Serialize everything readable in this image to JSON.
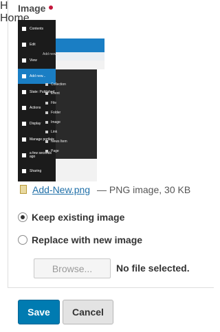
{
  "field": {
    "label": "Image"
  },
  "preview": {
    "toolbar_items": [
      "Contents",
      "Edit",
      "View",
      "Add new...",
      "State: Published",
      "Actions",
      "Display",
      "Manage portlets",
      "a few seconds ago",
      "Sharing"
    ],
    "submenu_title": "Add new...",
    "submenu_items": [
      "Collection",
      "Event",
      "File",
      "Folder",
      "Image",
      "Link",
      "News Item",
      "Page"
    ],
    "site_nav_text": "H",
    "breadcrumb_text": "Home"
  },
  "file": {
    "name": "Add-New.png",
    "meta": "— PNG image, 30 KB",
    "icon": "image-file-icon"
  },
  "options": {
    "keep_label": "Keep existing image",
    "replace_label": "Replace with new image",
    "selected": "keep"
  },
  "upload": {
    "browse_label": "Browse...",
    "status": "No file selected."
  },
  "actions": {
    "save_label": "Save",
    "cancel_label": "Cancel"
  },
  "colors": {
    "required": "#c4183c",
    "primary": "#007bb1",
    "link": "#1f6fa8"
  }
}
